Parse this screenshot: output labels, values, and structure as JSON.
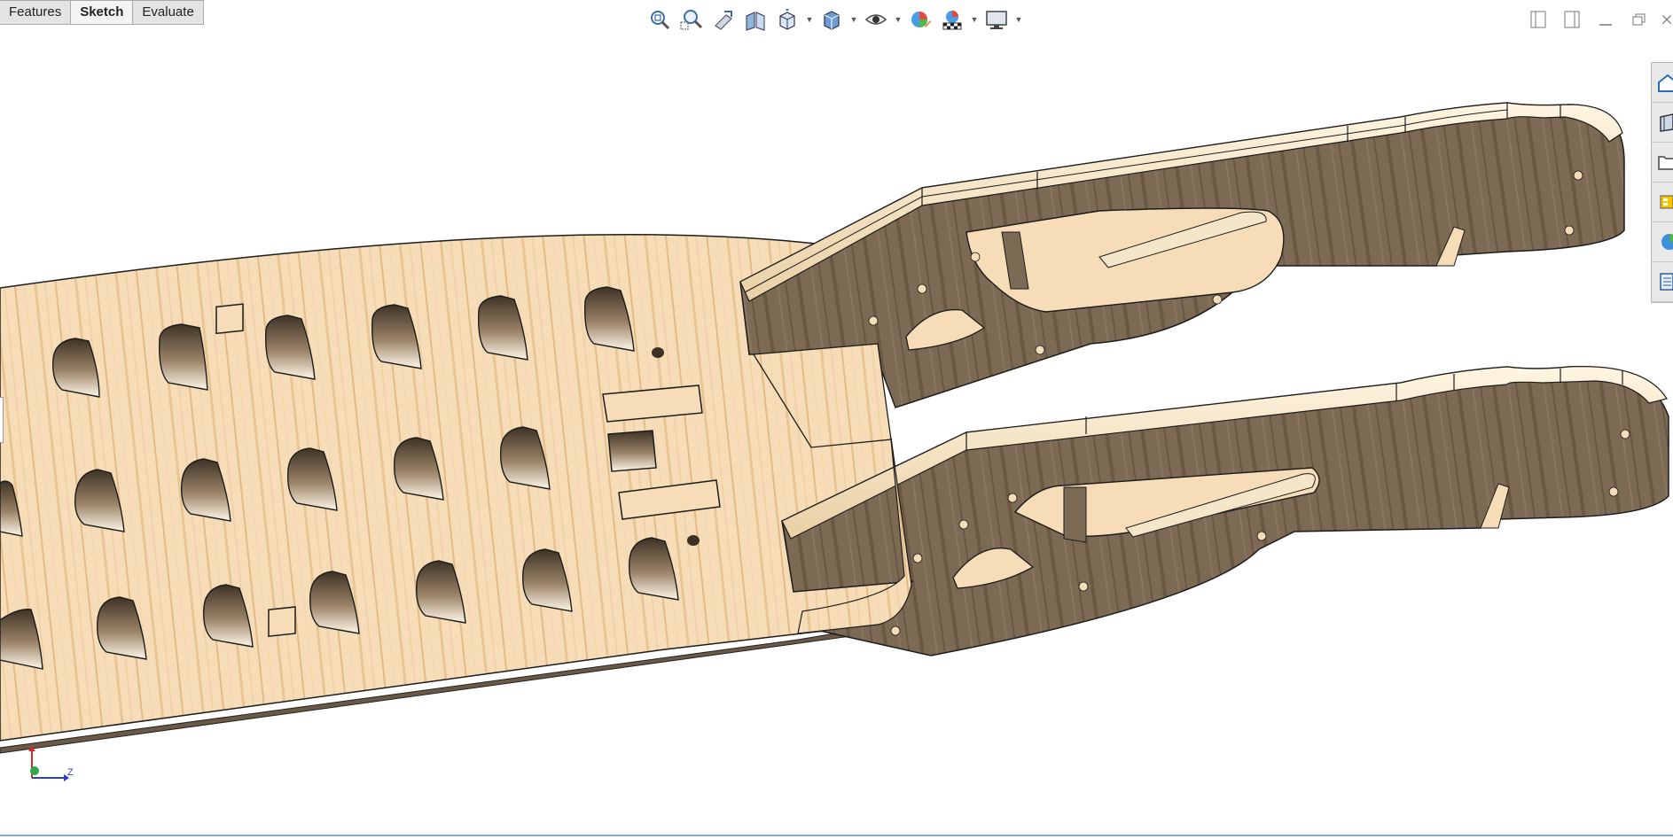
{
  "command_manager": {
    "tabs": [
      {
        "label": "Features",
        "active": false
      },
      {
        "label": "Sketch",
        "active": true
      },
      {
        "label": "Evaluate",
        "active": false
      }
    ]
  },
  "heads_up_toolbar": {
    "icons": [
      "zoom-to-fit-icon",
      "zoom-to-area-icon",
      "previous-view-icon",
      "section-view-icon",
      "view-orientation-icon",
      "display-style-icon",
      "hide-show-items-icon",
      "edit-appearance-icon",
      "apply-scene-icon",
      "view-settings-icon"
    ]
  },
  "task_pane": {
    "icons": [
      "home-icon",
      "design-library-icon",
      "file-explorer-icon",
      "view-palette-icon",
      "appearances-icon",
      "custom-properties-icon"
    ]
  },
  "triad": {
    "axis_label": "Z"
  },
  "colors": {
    "wood_face": "#f5dcb5",
    "wood_side": "#7a6650",
    "edge": "#1c1c1c",
    "tab_active": "#f4f4f4",
    "tab_inactive": "#e4e4e4"
  }
}
